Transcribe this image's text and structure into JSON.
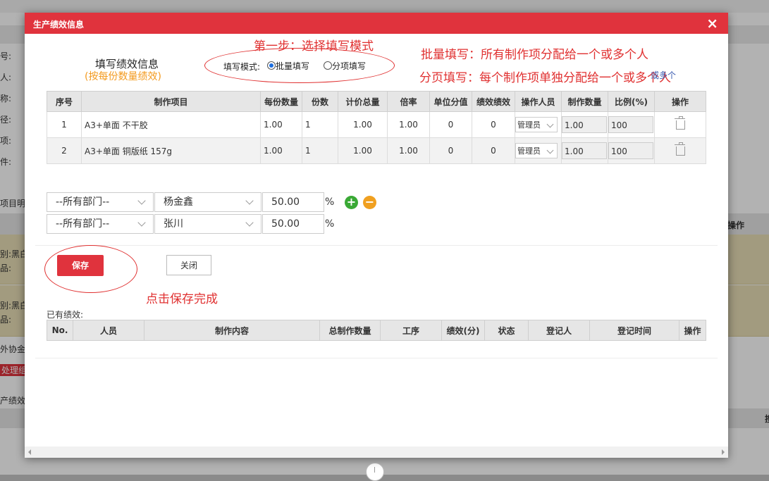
{
  "background": {
    "side_labels": [
      "号:",
      "人:",
      "称:",
      "径:",
      "项:",
      "件:"
    ],
    "section_label": "项目明细",
    "ops_header": "操作",
    "gold_rows": [
      {
        "line1": "别:黑白",
        "line2": "品:"
      },
      {
        "line1": "别:黑白",
        "line2": "品:"
      }
    ],
    "extra1": "外协金",
    "extra2": "处理组",
    "extra3": "产绩效",
    "extra4": "搜"
  },
  "dialog": {
    "title": "生产绩效信息",
    "close_icon": "×",
    "section_title": "填写绩效信息",
    "section_subtitle": "(按每份数量绩效)",
    "mode_label": "填写模式:",
    "mode_options": [
      "批量填写",
      "分项填写"
    ],
    "mode_selected": "批量填写",
    "annotations": {
      "step1": "第一步：选择填写模式",
      "batch": "批量填写：所有制作项分配给一个或多个人",
      "per_item": "分页填写：每个制作项单独分配给一个或多个人",
      "overlap": "或多个",
      "save_hint": "点击保存完成"
    },
    "items_table": {
      "headers": [
        "序号",
        "制作项目",
        "每份数量",
        "份数",
        "计价总量",
        "倍率",
        "单位分值",
        "绩效绩效",
        "操作人员",
        "制作数量",
        "比例(%)",
        "操作"
      ],
      "rows": [
        {
          "no": "1",
          "item": "A3+单面 不干胶",
          "per_qty": "1.00",
          "copies": "1",
          "total": "1.00",
          "rate": "1.00",
          "unit_score": "0",
          "perf": "0",
          "operator": "管理员",
          "make_qty": "1.00",
          "ratio": "100"
        },
        {
          "no": "2",
          "item": "A3+单面 铜版纸 157g",
          "per_qty": "1.00",
          "copies": "1",
          "total": "1.00",
          "rate": "1.00",
          "unit_score": "0",
          "perf": "0",
          "operator": "管理员",
          "make_qty": "1.00",
          "ratio": "100"
        }
      ]
    },
    "assign_rows": [
      {
        "dept": "--所有部门--",
        "person": "杨金鑫",
        "percent": "50.00",
        "unit": "%"
      },
      {
        "dept": "--所有部门--",
        "person": "张川",
        "percent": "50.00",
        "unit": "%"
      }
    ],
    "add_icon": "+",
    "remove_icon": "−",
    "save_label": "保存",
    "close_label": "关闭",
    "existing_label": "已有绩效:",
    "existing_table": {
      "headers": [
        "No.",
        "人员",
        "制作内容",
        "总制作数量",
        "工序",
        "绩效(分)",
        "状态",
        "登记人",
        "登记时间",
        "操作"
      ]
    }
  },
  "colors": {
    "header_red": "#e0333d",
    "annotation_red": "#e03030",
    "subtitle_orange": "#f39a1e",
    "add_green": "#3aa935",
    "remove_orange": "#f0a020"
  }
}
